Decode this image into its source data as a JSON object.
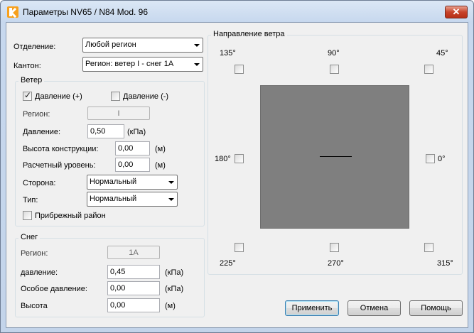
{
  "window": {
    "title": "Параметры  NV65 / N84 Mod. 96",
    "close_label": "✕"
  },
  "top": {
    "department_label": "Отделение:",
    "department_value": "Любой регион",
    "canton_label": "Кантон:",
    "canton_value": "Регион: ветер I - снег 1А"
  },
  "wind": {
    "group_title": "Ветер",
    "pressure_plus_label": "Давление (+)",
    "pressure_plus_checked": true,
    "pressure_minus_label": "Давление (-)",
    "pressure_minus_checked": false,
    "region_label": "Регион:",
    "region_value": "I",
    "pressure_label": "Давление:",
    "pressure_value": "0,50",
    "pressure_unit": "(кПа)",
    "height_label": "Высота конструкции:",
    "height_value": "0,00",
    "height_unit": "(м)",
    "level_label": "Расчетный уровень:",
    "level_value": "0,00",
    "level_unit": "(м)",
    "side_label": "Сторона:",
    "side_value": "Нормальный",
    "type_label": "Тип:",
    "type_value": "Нормальный",
    "coastal_label": "Прибрежный район",
    "coastal_checked": false
  },
  "snow": {
    "group_title": "Снег",
    "region_label": "Регион:",
    "region_value": "1A",
    "pressure_label": "давление:",
    "pressure_value": "0,45",
    "pressure_unit": "(кПа)",
    "special_label": "Особое давление:",
    "special_value": "0,00",
    "special_unit": "(кПа)",
    "height_label": "Высота",
    "height_value": "0,00",
    "height_unit": "(м)"
  },
  "direction": {
    "group_title": "Направление ветра",
    "d135": "135°",
    "d90": "90°",
    "d45": "45°",
    "d180": "180°",
    "d0": "0°",
    "d225": "225°",
    "d270": "270°",
    "d315": "315°"
  },
  "buttons": {
    "apply": "Применить",
    "cancel": "Отмена",
    "help": "Помощь"
  }
}
